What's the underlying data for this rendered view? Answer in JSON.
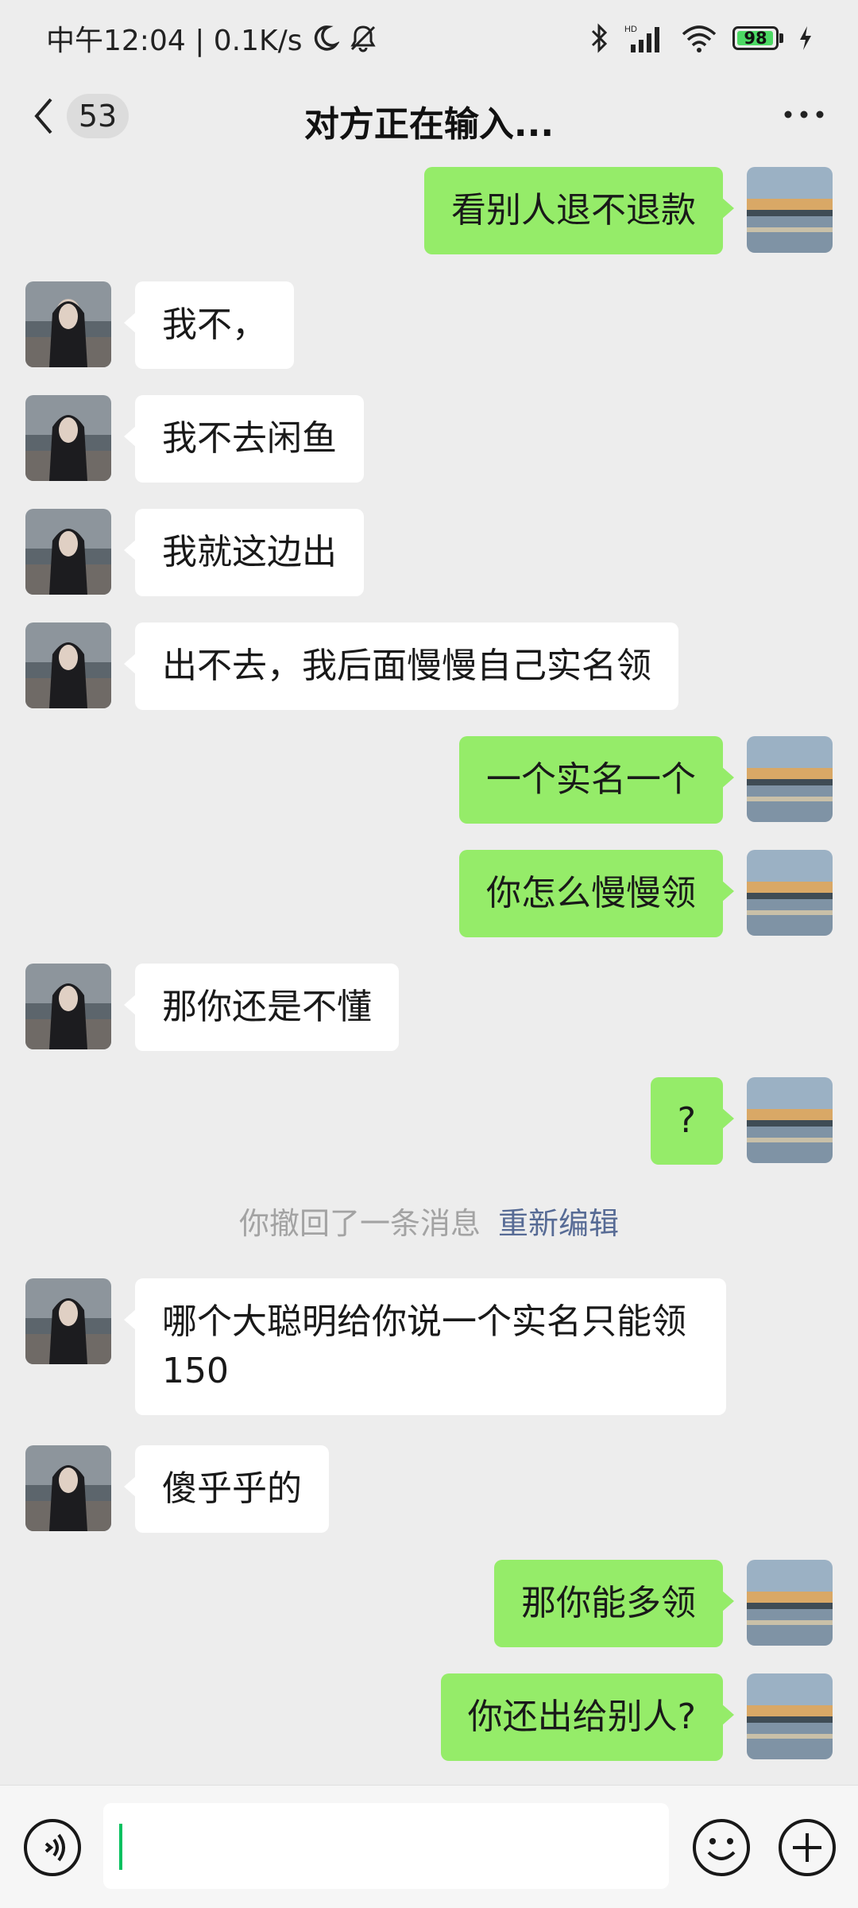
{
  "status_bar": {
    "time_left": "中午12:04 | 0.1K/s",
    "battery": "98"
  },
  "nav": {
    "unread_count": "53",
    "title": "对方正在输入..."
  },
  "messages": [
    {
      "from": "me",
      "text": "看别人退不退款"
    },
    {
      "from": "them",
      "text": "我不，"
    },
    {
      "from": "them",
      "text": "我不去闲鱼"
    },
    {
      "from": "them",
      "text": "我就这边出"
    },
    {
      "from": "them",
      "text": "出不去，我后面慢慢自己实名领"
    },
    {
      "from": "me",
      "text": "一个实名一个"
    },
    {
      "from": "me",
      "text": "你怎么慢慢领"
    },
    {
      "from": "them",
      "text": "那你还是不懂"
    },
    {
      "from": "me",
      "text": "?"
    },
    {
      "from": "them",
      "text": "哪个大聪明给你说一个实名只能领150"
    },
    {
      "from": "them",
      "text": "傻乎乎的"
    },
    {
      "from": "me",
      "text": "那你能多领"
    },
    {
      "from": "me",
      "text": "你还出给别人?"
    }
  ],
  "recall_notice": {
    "text": "你撤回了一条消息",
    "edit_label": "重新编辑"
  },
  "input": {
    "value": ""
  },
  "colors": {
    "background": "#ededed",
    "out_bubble": "#95ec69",
    "in_bubble": "#ffffff",
    "link": "#576b95"
  }
}
